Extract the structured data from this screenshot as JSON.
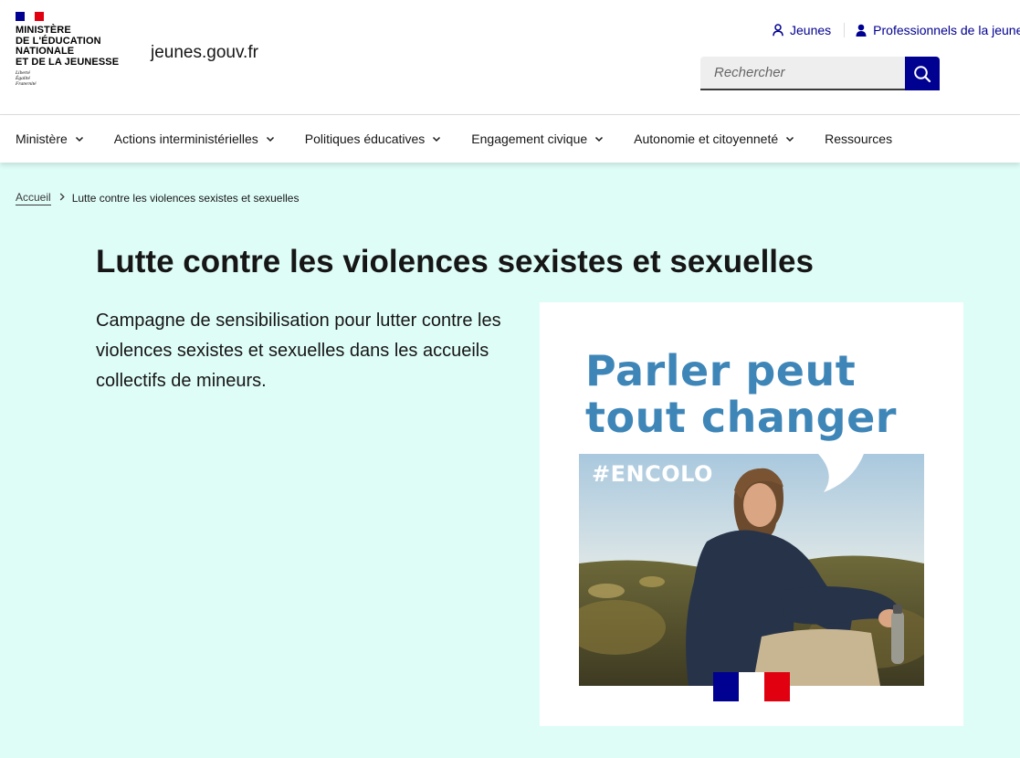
{
  "header": {
    "ministry_lines": [
      "MINISTÈRE",
      "DE L'ÉDUCATION",
      "NATIONALE",
      "ET DE LA JEUNESSE"
    ],
    "motto_lines": [
      "Liberté",
      "Égalité",
      "Fraternité"
    ],
    "service_title": "jeunes.gouv.fr",
    "quick_links": [
      {
        "label": "Jeunes",
        "icon": "user-outline-icon"
      },
      {
        "label": "Professionnels de la jeunesse",
        "icon": "user-filled-icon"
      }
    ],
    "search": {
      "placeholder": "Rechercher",
      "button_icon": "search-icon"
    }
  },
  "nav": {
    "items": [
      {
        "label": "Ministère",
        "has_dropdown": true
      },
      {
        "label": "Actions interministérielles",
        "has_dropdown": true
      },
      {
        "label": "Politiques éducatives",
        "has_dropdown": true
      },
      {
        "label": "Engagement civique",
        "has_dropdown": true
      },
      {
        "label": "Autonomie et citoyenneté",
        "has_dropdown": true
      },
      {
        "label": "Ressources",
        "has_dropdown": false
      }
    ]
  },
  "breadcrumb": {
    "home": "Accueil",
    "current": "Lutte contre les violences sexistes et sexuelles"
  },
  "main": {
    "title": "Lutte contre les violences sexistes et sexuelles",
    "lead": "Campagne de sensibilisation pour lutter contre les violences sexistes et sexuelles dans les accueils collectifs de mineurs.",
    "poster": {
      "headline_lines": [
        "Parler peut",
        "tout changer"
      ],
      "hashtag": "#ENCOLO"
    }
  },
  "colors": {
    "brand_blue": "#000091",
    "marianne_red": "#e1000f",
    "page_background": "#dffdf7",
    "poster_headline": "#3f86b8"
  }
}
